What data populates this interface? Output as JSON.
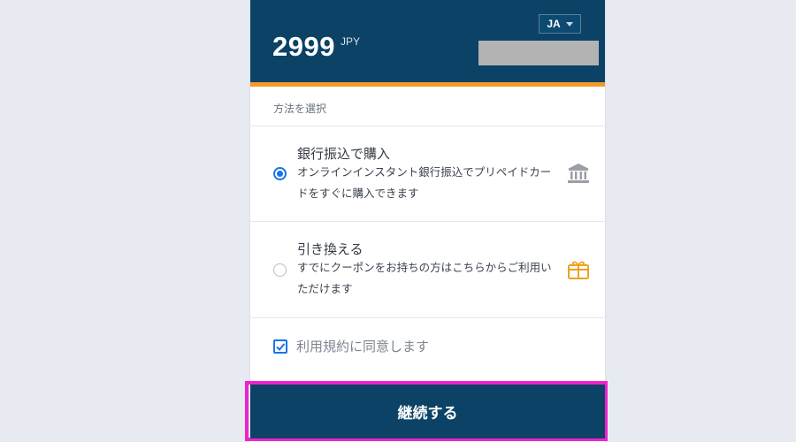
{
  "header": {
    "price": "2999",
    "currency": "JPY",
    "language": "JA"
  },
  "section_title": "方法を選択",
  "options": [
    {
      "title": "銀行振込で購入",
      "description": "オンラインインスタント銀行振込でプリペイドカードをすぐに購入できます",
      "selected": true,
      "icon": "bank-icon"
    },
    {
      "title": "引き換える",
      "description": "すでにクーポンをお持ちの方はこちらからご利用いただけます",
      "selected": false,
      "icon": "gift-icon"
    }
  ],
  "agree": {
    "label": "利用規約に同意します",
    "checked": true
  },
  "continue_label": "継続する",
  "colors": {
    "header": "#0b4266",
    "accent_bar": "#f39a2b",
    "radio_blue": "#1a73e8",
    "highlight": "#ee22cc"
  }
}
